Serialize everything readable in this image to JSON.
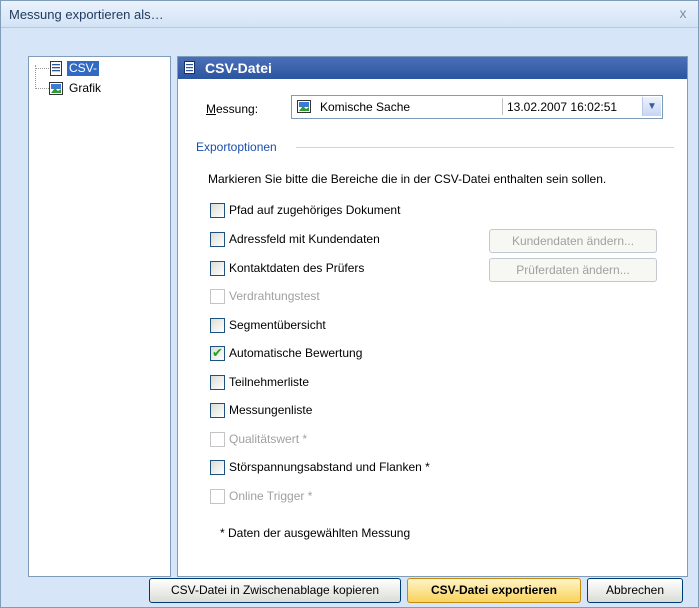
{
  "window": {
    "title": "Messung exportieren als…",
    "close_glyph": "x"
  },
  "tree": {
    "items": [
      {
        "label": "CSV-Datei",
        "icon": "document-icon"
      },
      {
        "label": "Grafik",
        "icon": "image-icon"
      }
    ]
  },
  "panel": {
    "title": "CSV-Datei",
    "measurement_label": "Messung:",
    "measurement_label_accesskey": "M",
    "measurement_label_rest": "essung:",
    "measurement_name": "Komische Sache",
    "measurement_date": "13.02.2007  16:02:51",
    "group_label": "Exportoptionen",
    "instruction": "Markieren Sie bitte die Bereiche die in der CSV-Datei enthalten sein sollen.",
    "options": [
      {
        "label": "Pfad auf zugehöriges Dokument",
        "checked": false,
        "enabled": true
      },
      {
        "label": "Adressfeld mit Kundendaten",
        "checked": false,
        "enabled": true
      },
      {
        "label": "Kontaktdaten des Prüfers",
        "checked": false,
        "enabled": true
      },
      {
        "label": "Verdrahtungstest",
        "checked": false,
        "enabled": false
      },
      {
        "label": "Segmentübersicht",
        "checked": false,
        "enabled": true
      },
      {
        "label": "Automatische Bewertung",
        "checked": true,
        "enabled": true
      },
      {
        "label": "Teilnehmerliste",
        "checked": false,
        "enabled": true
      },
      {
        "label": "Messungenliste",
        "checked": false,
        "enabled": true
      },
      {
        "label": "Qualitätswert *",
        "checked": false,
        "enabled": false
      },
      {
        "label": "Störspannungsabstand und Flanken *",
        "checked": false,
        "enabled": true
      },
      {
        "label": "Online Trigger *",
        "checked": false,
        "enabled": false
      }
    ],
    "customer_button": "Kundendaten ändern...",
    "tester_button": "Prüferdaten ändern...",
    "footnote": "* Daten der ausgewählten Messung"
  },
  "buttons": {
    "copy": "CSV-Datei in Zwischenablage kopieren",
    "export": "CSV-Datei exportieren",
    "cancel": "Abbrechen"
  },
  "colors": {
    "accent": "#316ac5",
    "header": "#2c559f",
    "group": "#1a4faa",
    "check": "#21a121"
  }
}
